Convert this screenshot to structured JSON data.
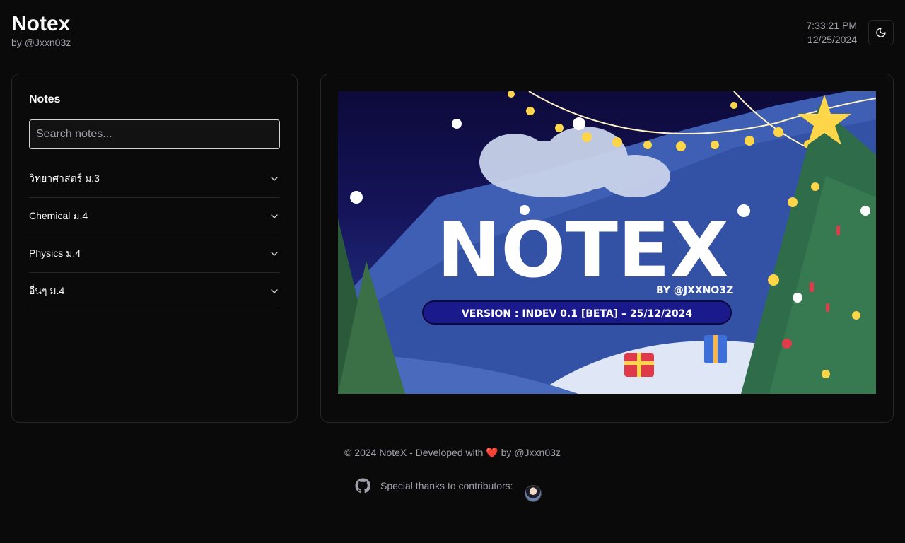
{
  "header": {
    "title": "Notex",
    "by_prefix": "by",
    "author_link": "@Jxxn03z",
    "time": "7:33:21 PM",
    "date": "12/25/2024",
    "theme_toggle_icon": "moon-icon"
  },
  "notes": {
    "title": "Notes",
    "search_placeholder": "Search notes...",
    "items": [
      {
        "label": "วิทยาศาสตร์ ม.3"
      },
      {
        "label": "Chemical ม.4"
      },
      {
        "label": "Physics ม.4"
      },
      {
        "label": "อื่นๆ ม.4"
      }
    ]
  },
  "banner": {
    "logo_text": "NOTEX",
    "by_text": "BY @JXXNO3Z",
    "version_text": "VERSION : INDEV 0.1 [BETA] – 25/12/2024"
  },
  "footer": {
    "copyright": "© 2024 NoteX - Developed with",
    "heart": "❤️",
    "by": "by",
    "author_link": "@Jxxn03z",
    "thanks": "Special thanks to contributors:",
    "github_icon": "github-icon"
  },
  "colors": {
    "background": "#0a0a0a",
    "border": "#27272a",
    "muted": "#a1a1aa",
    "banner_navy": "#0d0a3a",
    "banner_pill": "#1a1a8c"
  }
}
